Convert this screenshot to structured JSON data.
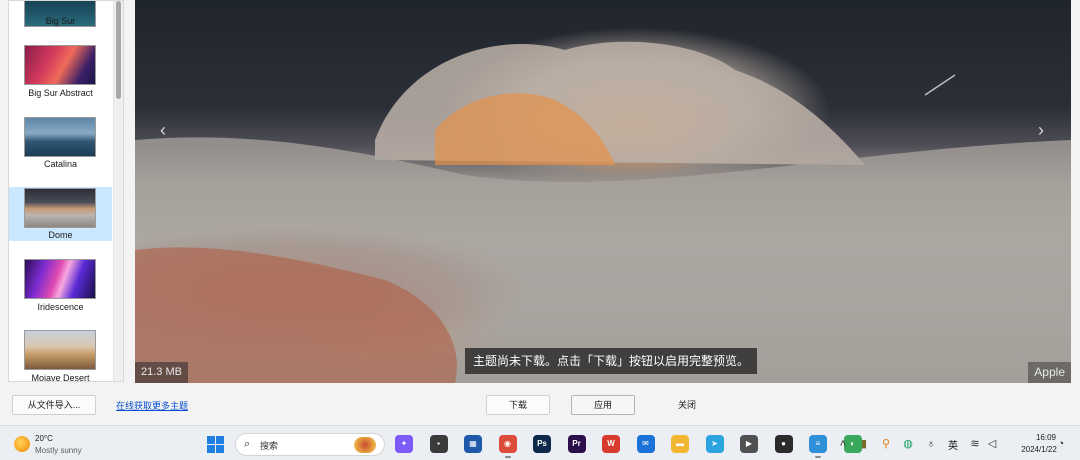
{
  "themes": [
    {
      "label": "Big Sur",
      "thumb": "big-sur-wallpaper"
    },
    {
      "label": "Big Sur Abstract",
      "thumb": "big-sur-abstract-wallpaper"
    },
    {
      "label": "Catalina",
      "thumb": "catalina-wallpaper"
    },
    {
      "label": "Dome",
      "thumb": "dome-wallpaper",
      "selected": true
    },
    {
      "label": "Iridescence",
      "thumb": "iridescence-wallpaper"
    },
    {
      "label": "Mojave Desert",
      "thumb": "mojave-desert-wallpaper"
    }
  ],
  "preview": {
    "caption": "主题尚未下载。点击「下载」按钮以启用完整预览。",
    "file_size": "21.3 MB",
    "author": "Apple",
    "prev_icon": "chevron-left-icon",
    "next_icon": "chevron-right-icon"
  },
  "actions": {
    "import_label": "从文件导入...",
    "get_more_label": "在线获取更多主题",
    "download_label": "下载",
    "apply_label": "应用",
    "close_label": "关闭"
  },
  "taskbar": {
    "weather": {
      "temp": "20°C",
      "desc": "Mostly sunny"
    },
    "search_placeholder": "搜索",
    "apps": [
      {
        "name": "copilot",
        "color": "#7a5af8",
        "glyph": "✦"
      },
      {
        "name": "task-view",
        "color": "#3a3a3a",
        "glyph": "▪"
      },
      {
        "name": "microsoft-store",
        "color": "#1f5aa8",
        "glyph": "▦"
      },
      {
        "name": "chrome",
        "color": "#dd4b39",
        "glyph": "◉"
      },
      {
        "name": "photoshop",
        "color": "#0e2a4a",
        "glyph": "Ps"
      },
      {
        "name": "premiere",
        "color": "#2a0f4a",
        "glyph": "Pr"
      },
      {
        "name": "wps",
        "color": "#d83a2f",
        "glyph": "W"
      },
      {
        "name": "mail",
        "color": "#1b73d8",
        "glyph": "✉"
      },
      {
        "name": "file-explorer",
        "color": "#f2b632",
        "glyph": "▬"
      },
      {
        "name": "telegram",
        "color": "#2aa3df",
        "glyph": "➤"
      },
      {
        "name": "media-player",
        "color": "#505050",
        "glyph": "▶"
      },
      {
        "name": "obs",
        "color": "#2b2b2b",
        "glyph": "●"
      },
      {
        "name": "notepad",
        "color": "#2f8fd8",
        "glyph": "≡"
      },
      {
        "name": "color-app",
        "color": "#3aa85a",
        "glyph": "◐"
      }
    ],
    "tray": {
      "input_mode": "英",
      "time": "16:09",
      "date": "2024/1/22"
    }
  },
  "colors": {
    "accent": "#0a4fd0",
    "selection": "#cce8ff",
    "taskbar": "#ebeff4"
  }
}
